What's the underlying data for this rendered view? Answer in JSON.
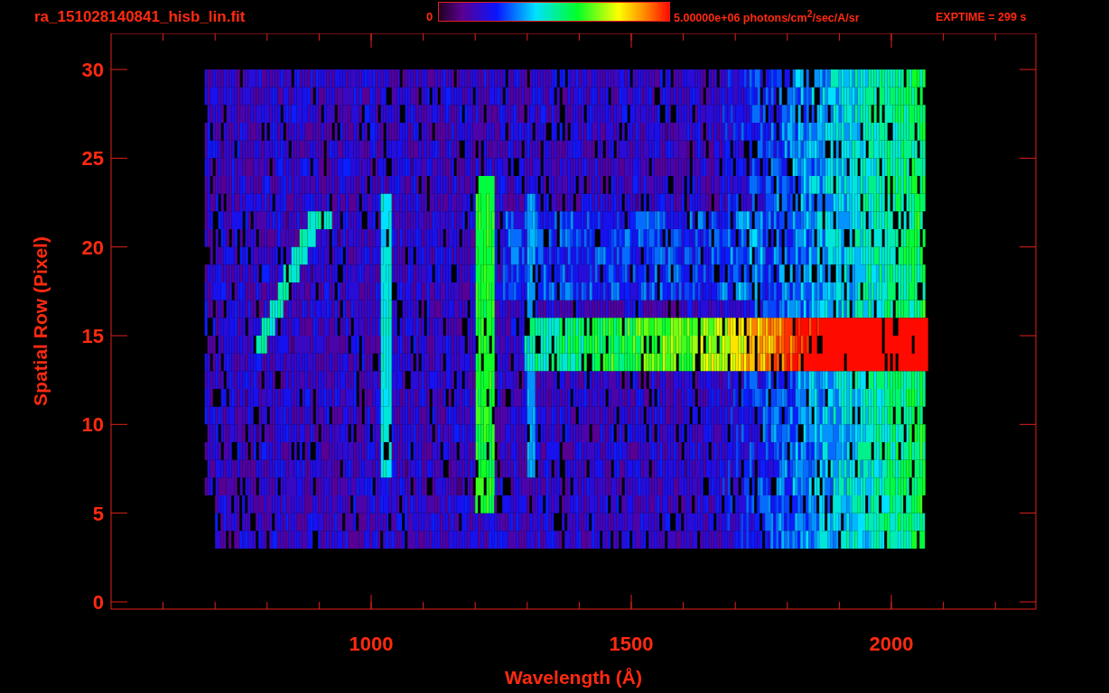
{
  "title": "ra_151028140841_hisb_lin.fit",
  "colorbar": {
    "min_label": "0",
    "max_label": "5.00000e+06 photons/cm$^{2}$/sec/A/sr"
  },
  "exposure": "EXPTIME = 299 s",
  "y_axis": {
    "label": "Spatial Row (Pixel)",
    "ticks": [
      "30",
      "25",
      "20",
      "15",
      "10",
      "5",
      "0"
    ]
  },
  "x_axis": {
    "label": "Wavelength (Å)",
    "ticks": [
      "1000",
      "1500",
      "2000"
    ]
  }
}
